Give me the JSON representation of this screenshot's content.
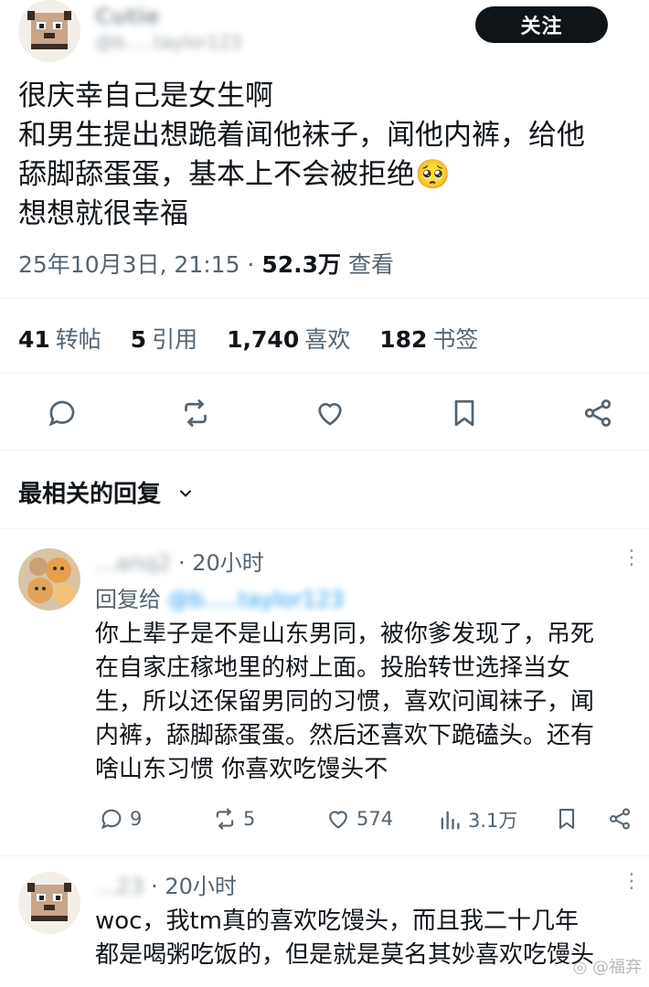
{
  "post": {
    "author_name": "Cutie",
    "author_handle": "@b.....taylor123",
    "follow_label": "关注",
    "lines": [
      "很庆幸自己是女生啊",
      "和男生提出想跪着闻他袜子，闻他内裤，给他",
      "舔脚舔蛋蛋，基本上不会被拒绝🥺",
      "想想就很幸福"
    ],
    "date": "25年10月3日, 21:15",
    "views": "52.3万",
    "views_label": "查看",
    "stats": [
      {
        "value": "41",
        "label": "转帖"
      },
      {
        "value": "5",
        "label": "引用"
      },
      {
        "value": "1,740",
        "label": "喜欢"
      },
      {
        "value": "182",
        "label": "书签"
      }
    ]
  },
  "actions": [
    "comment-icon",
    "repost-icon",
    "heart-icon",
    "bookmark-icon",
    "share-icon"
  ],
  "replies_header": "最相关的回复",
  "reply1": {
    "name": "...anq2",
    "time": "· 20小时",
    "reply_to_label": "回复给",
    "reply_to_handle": "@b.....taylor123",
    "lines": [
      "你上辈子是不是山东男同，被你爹发现了，吊死",
      "在自家庄稼地里的树上面。投胎转世选择当女",
      "生，所以还保留男同的习惯，喜欢问闻袜子，闻",
      "内裤，舔脚舔蛋蛋。然后还喜欢下跪磕头。还有",
      "啥山东习惯 你喜欢吃馒头不"
    ],
    "comments": "9",
    "reposts": "5",
    "likes": "574",
    "views": "3.1万"
  },
  "reply2": {
    "name": "...23",
    "time": "· 20小时",
    "lines": [
      "woc，我tm真的喜欢吃馒头，而且我二十几年",
      "都是喝粥吃饭的，但是就是莫名其妙喜欢吃馒头"
    ]
  },
  "watermark": "◎ @福弃",
  "colors": {
    "text": "#0f1419",
    "secondary": "#536471",
    "divider": "#eff3f4",
    "button": "#0f1419"
  }
}
